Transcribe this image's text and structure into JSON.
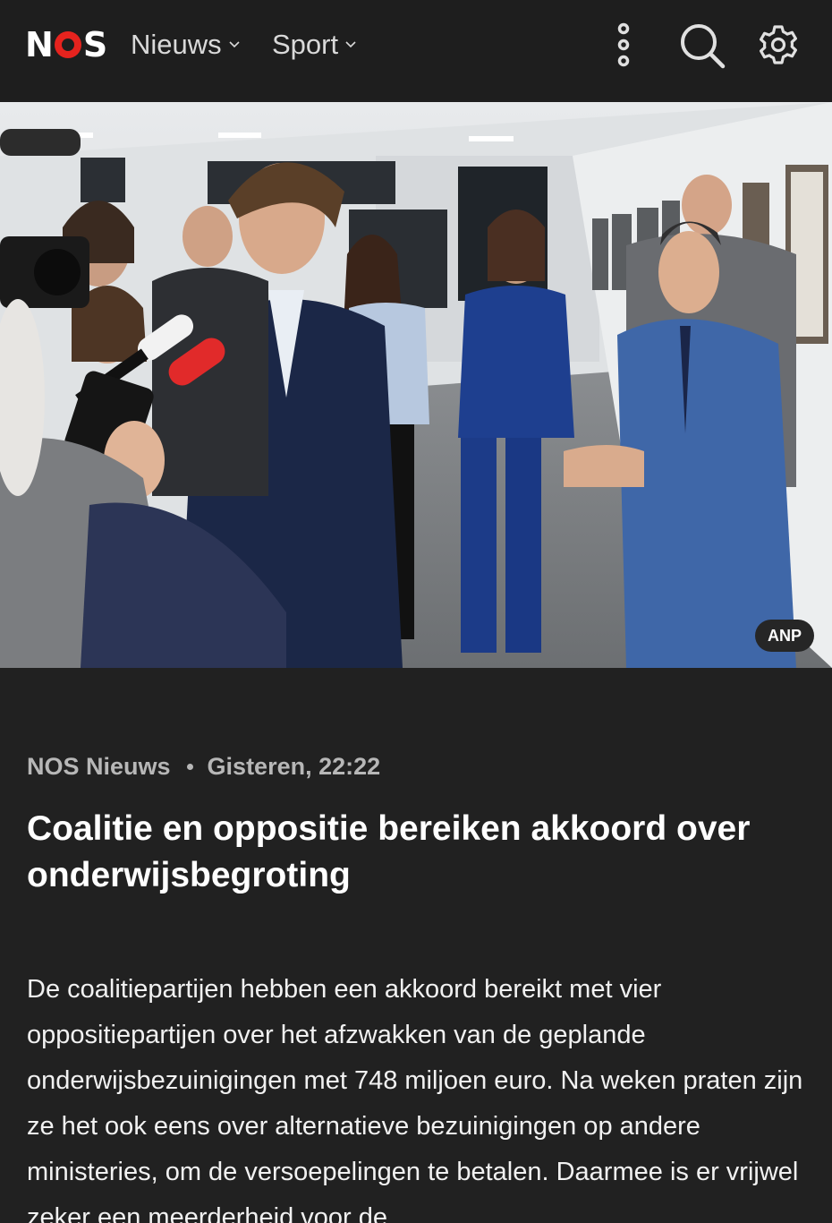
{
  "header": {
    "logo_text": "NOS",
    "nav": [
      {
        "label": "Nieuws"
      },
      {
        "label": "Sport"
      }
    ],
    "icons": [
      "more-vertical-icon",
      "search-icon",
      "settings-gear-icon"
    ],
    "brand_color": "#e6231e",
    "background": "#1e1e1e"
  },
  "hero": {
    "credit": "ANP"
  },
  "article": {
    "source": "NOS Nieuws",
    "timestamp": "Gisteren, 22:22",
    "title": "Coalitie en oppositie bereiken akkoord over onderwijsbegroting",
    "paragraph": "De coalitiepartijen hebben een akkoord bereikt met vier oppositiepartijen over het afzwakken van de geplande onderwijsbezuinigingen met 748 miljoen euro. Na weken praten zijn ze het ook eens over alternatieve bezuinigingen op andere ministeries, om de versoepelingen te betalen. Daarmee is er vrijwel zeker een meerderheid voor de"
  }
}
